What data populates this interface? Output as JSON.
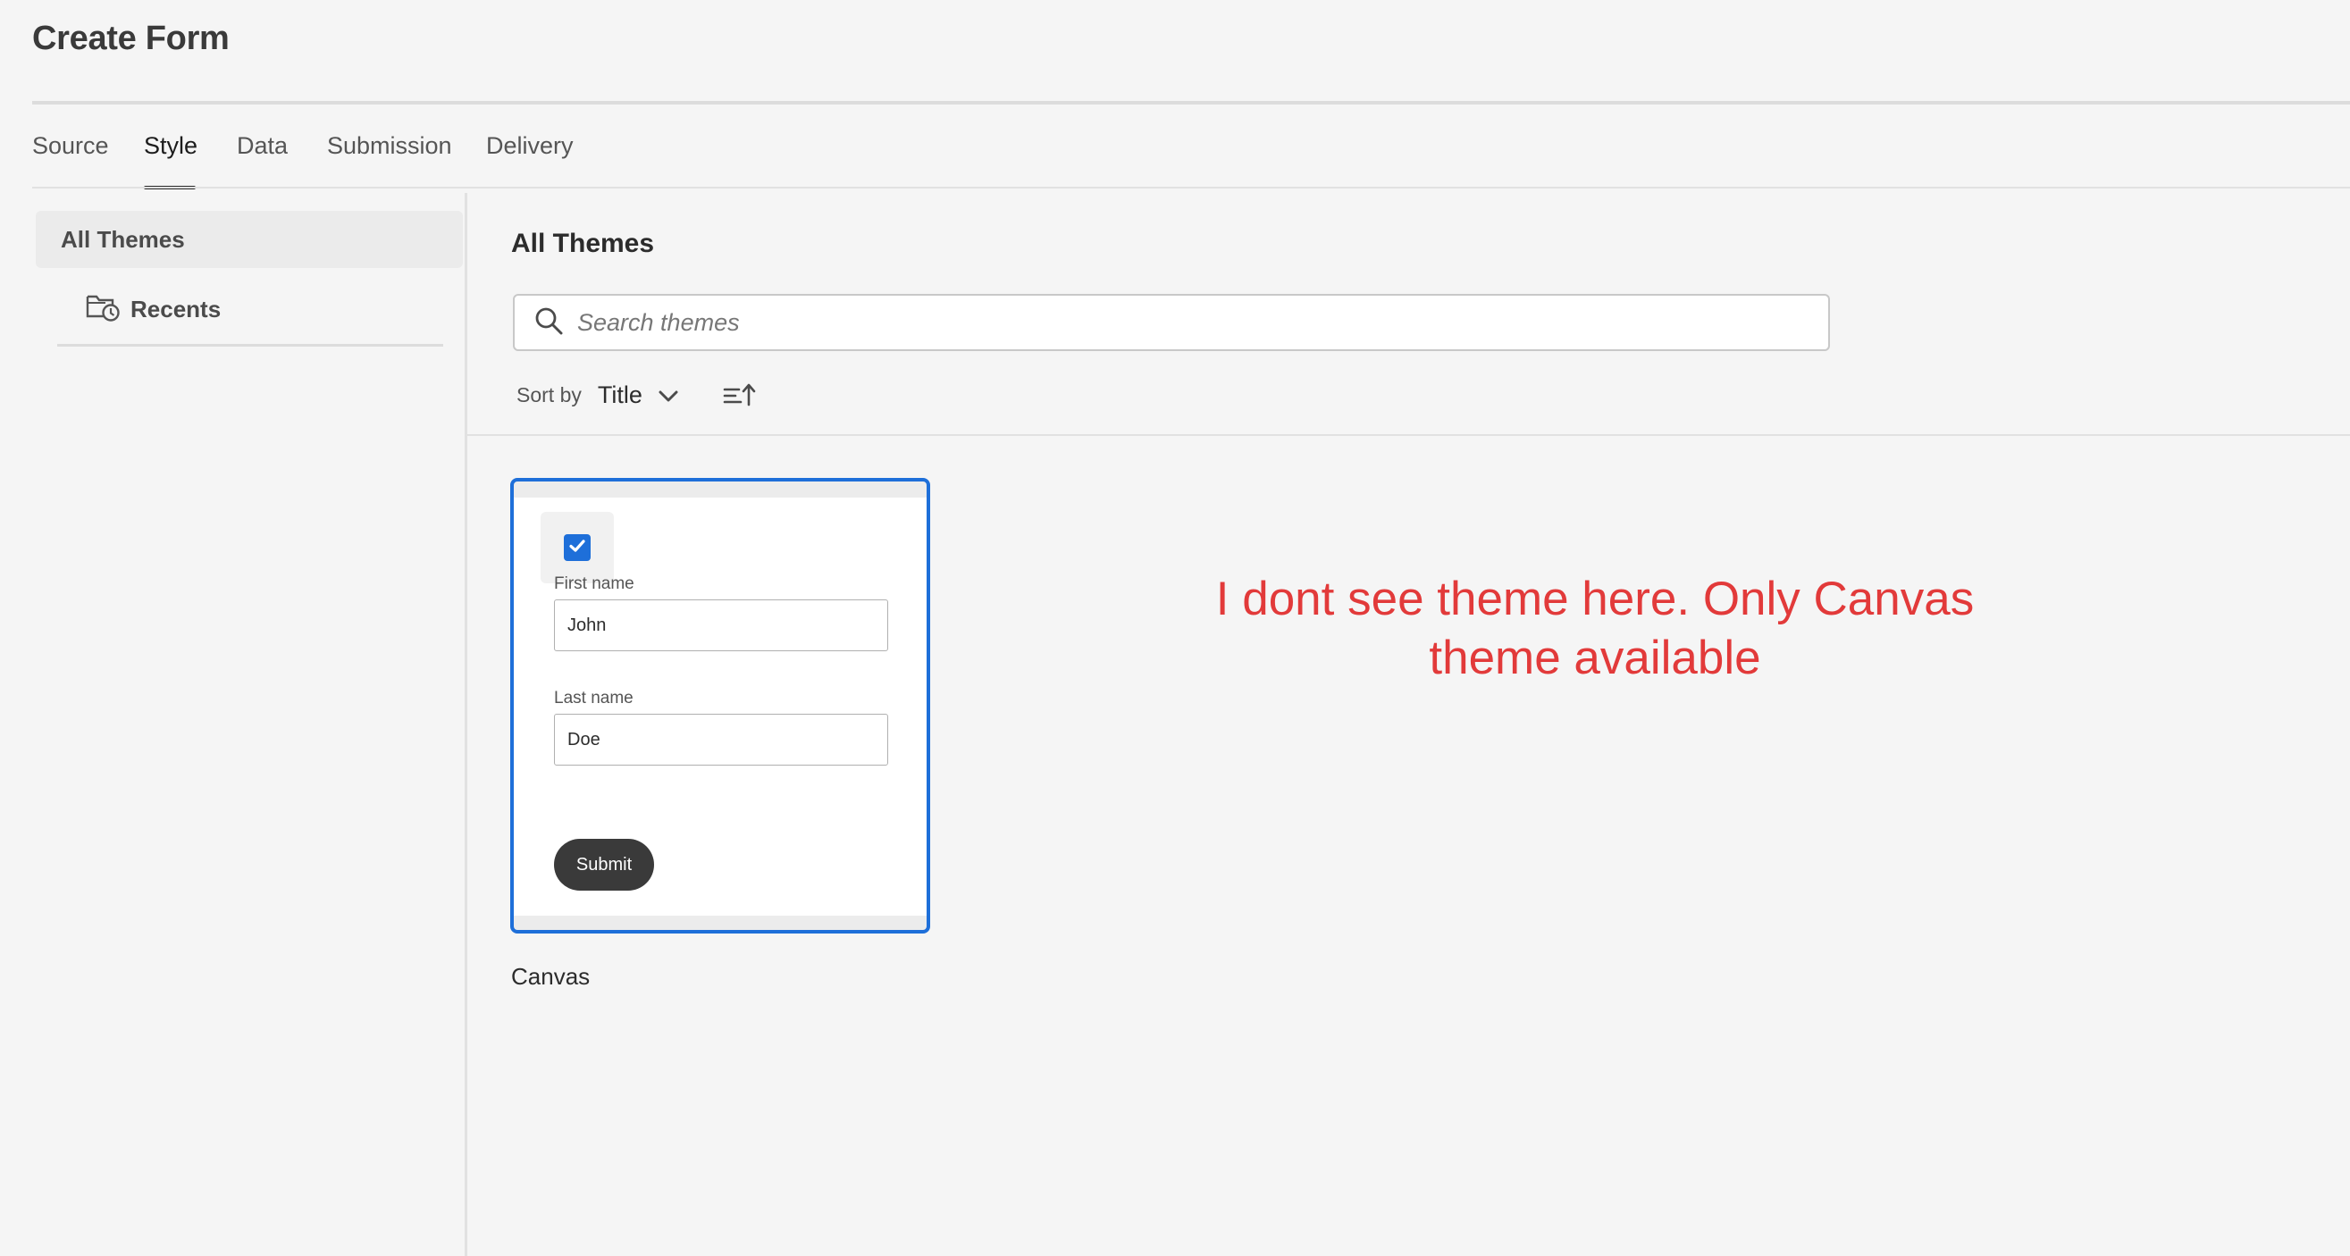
{
  "header": {
    "title": "Create Form"
  },
  "tabs": [
    {
      "label": "Source",
      "active": false
    },
    {
      "label": "Style",
      "active": true
    },
    {
      "label": "Data",
      "active": false
    },
    {
      "label": "Submission",
      "active": false
    },
    {
      "label": "Delivery",
      "active": false
    }
  ],
  "sidebar": {
    "items": [
      {
        "label": "All Themes",
        "selected": true
      },
      {
        "label": "Recents",
        "icon": "folder-clock-icon"
      }
    ]
  },
  "main": {
    "title": "All Themes",
    "search": {
      "placeholder": "Search themes",
      "value": "",
      "icon": "search-icon"
    },
    "sort": {
      "label": "Sort by",
      "value": "Title",
      "order_icon": "sort-ascending-icon"
    },
    "themes": [
      {
        "name": "Canvas",
        "selected": true,
        "preview": {
          "checkbox_checked": true,
          "fields": [
            {
              "label": "First name",
              "value": "John"
            },
            {
              "label": "Last name",
              "value": "Doe"
            }
          ],
          "button_label": "Submit"
        }
      }
    ]
  },
  "annotation": {
    "line1": "I dont see theme here. Only Canvas",
    "line2": "theme available",
    "color": "#e23a3a"
  },
  "colors": {
    "accent": "#1e6fd9",
    "background": "#f5f5f5",
    "annotation": "#e23a3a"
  }
}
